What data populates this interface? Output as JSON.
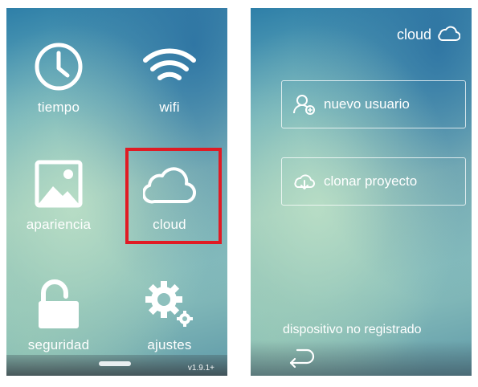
{
  "left_screen": {
    "tiles": [
      {
        "label": "tiempo",
        "icon": "clock-icon"
      },
      {
        "label": "wifi",
        "icon": "wifi-icon"
      },
      {
        "label": "apariencia",
        "icon": "image-icon"
      },
      {
        "label": "cloud",
        "icon": "cloud-icon"
      },
      {
        "label": "seguridad",
        "icon": "unlock-icon"
      },
      {
        "label": "ajustes",
        "icon": "gears-icon"
      }
    ],
    "highlighted_tile": "cloud",
    "highlight_color": "#e01b24",
    "version": "v1.9.1+"
  },
  "right_screen": {
    "header": {
      "label": "cloud",
      "icon": "cloud-icon"
    },
    "buttons": [
      {
        "label": "nuevo usuario",
        "icon": "add-user-icon"
      },
      {
        "label": "clonar proyecto",
        "icon": "cloud-download-icon"
      }
    ],
    "status": "dispositivo no registrado",
    "back_icon": "back-arrow-icon"
  }
}
